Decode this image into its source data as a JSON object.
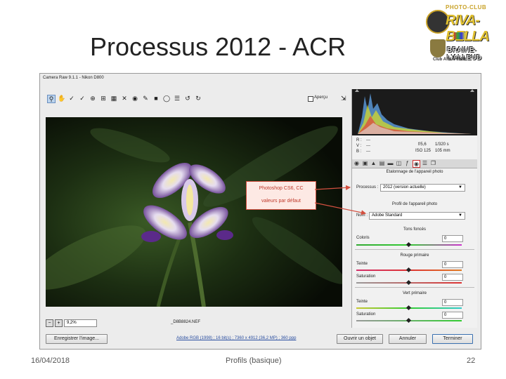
{
  "slide": {
    "title": "Processus 2012 - ACR",
    "footer_date": "16/04/2018",
    "footer_center": "Profils (basique)",
    "page_number": "22"
  },
  "logo": {
    "line1": "PHOTO-CLUB",
    "line2": "RIVA-BELLA",
    "line3": "BRAINE-L'ALLEUD",
    "line4": "Club Affilié FIAP"
  },
  "acr": {
    "window_title": "Camera Raw 9.1.1  -  Nikon D800",
    "preview_label": "Aperçu",
    "zoom_value": "9,2%",
    "filename": "_D8B8824.NEF",
    "info_link": "Adobe RGB (1998) ; 16 bit(s) ; 7360 x 4912 (36,2 MP) ; 360 ppp",
    "buttons": {
      "save": "Enregistrer l'image...",
      "open": "Ouvrir un objet",
      "cancel": "Annuler",
      "done": "Terminer"
    },
    "readout": {
      "r": "R :",
      "v": "V :",
      "b": "B :",
      "r_val": "---",
      "v_val": "---",
      "b_val": "---",
      "aperture": "f/5,6",
      "shutter": "1/320 s",
      "iso": "ISO 125",
      "focal": "105 mm"
    },
    "panel": {
      "tab_title": "Etalonnage de l'appareil photo",
      "process_label": "Processus :",
      "process_value": "2012 (version actuelle)",
      "profile_section": "Profil de l'appareil photo",
      "name_label": "Nom :",
      "name_value": "Adobe Standard",
      "shadows_title": "Tons foncés",
      "hue_colors_label": "Coloris",
      "hue_colors_value": "0",
      "red_title": "Rouge primaire",
      "red_hue_label": "Teinte",
      "red_hue_value": "0",
      "red_sat_label": "Saturation",
      "red_sat_value": "0",
      "green_title": "Vert primaire",
      "green_hue_label": "Teinte",
      "green_hue_value": "0",
      "green_sat_label": "Saturation",
      "green_sat_value": "0"
    },
    "callout": {
      "line1": "Photoshop CS6, CC",
      "line2": "valeurs par défaut"
    }
  },
  "colors": {
    "callout_border": "#d35040",
    "callout_text": "#c0392b",
    "link": "#2a4ea0"
  }
}
